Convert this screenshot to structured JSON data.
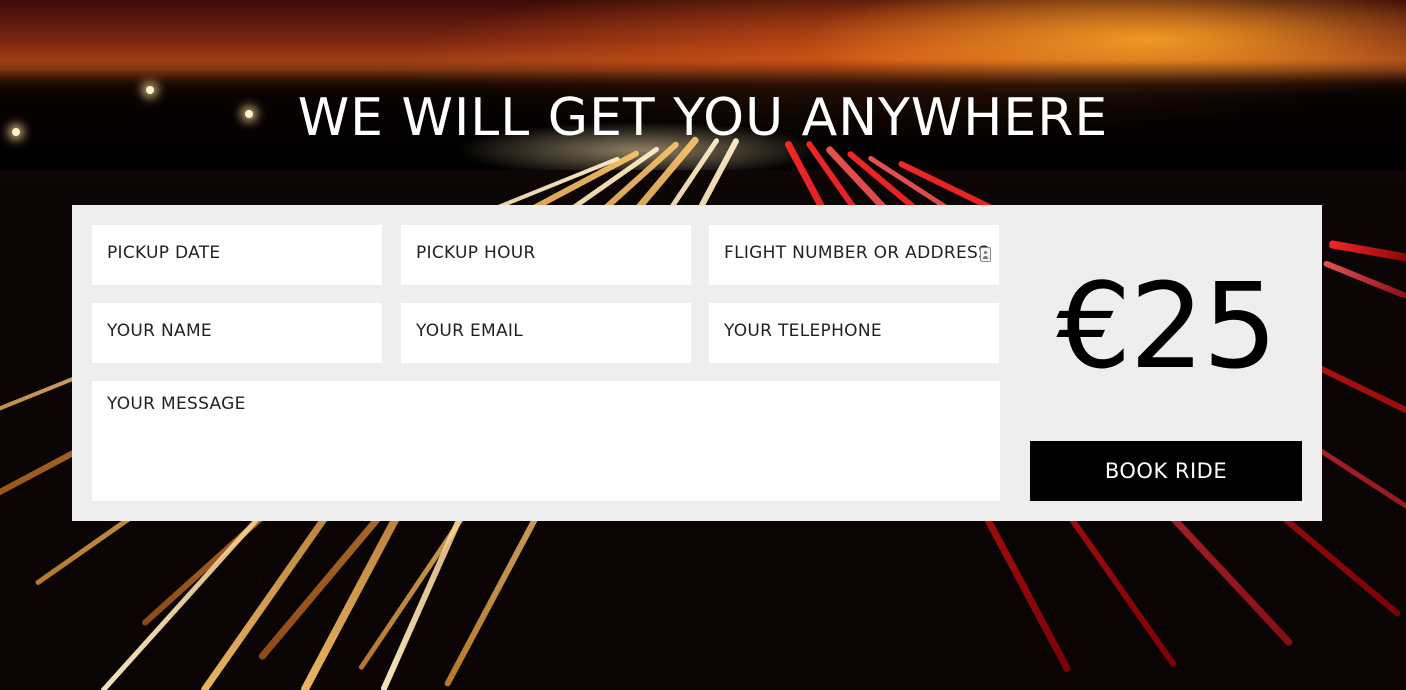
{
  "hero": {
    "headline": "WE WILL GET YOU ANYWHERE"
  },
  "form": {
    "pickup_date": {
      "placeholder": "PICKUP DATE"
    },
    "pickup_hour": {
      "placeholder": "PICKUP HOUR"
    },
    "flight_or_address": {
      "placeholder": "FLIGHT NUMBER OR ADDRESS",
      "icon": "contact-card-icon"
    },
    "name": {
      "placeholder": "YOUR NAME"
    },
    "email": {
      "placeholder": "YOUR EMAIL"
    },
    "telephone": {
      "placeholder": "YOUR TELEPHONE"
    },
    "message": {
      "placeholder": "YOUR MESSAGE"
    }
  },
  "pricing": {
    "price": "€25"
  },
  "actions": {
    "book_label": "BOOK RIDE"
  },
  "colors": {
    "panel_bg": "#eeeeee",
    "field_bg": "#ffffff",
    "button_bg": "#000000",
    "button_text": "#ffffff",
    "headline_text": "#ffffff"
  }
}
